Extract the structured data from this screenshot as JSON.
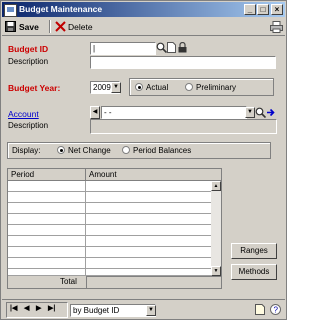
{
  "window": {
    "title": "Budget Maintenance",
    "minimize": "_",
    "maximize": "□",
    "close": "×"
  },
  "toolbar": {
    "save_label": "Save",
    "delete_label": "Delete"
  },
  "form": {
    "budget_id_label": "Budget ID",
    "budget_id_value": "|",
    "description_label": "Description",
    "description_value": "",
    "budget_year_label": "Budget Year:",
    "budget_year_value": "2009",
    "year_type_options": [
      "Actual",
      "Preliminary"
    ],
    "year_type_selected": "Actual",
    "account_label": "Account",
    "account_value": "   -   -",
    "account_description_label": "Description",
    "account_description_value": ""
  },
  "display": {
    "label": "Display:",
    "options": [
      "Net Change",
      "Period Balances"
    ],
    "selected": "Net Change"
  },
  "grid": {
    "columns": [
      "Period",
      "Amount"
    ],
    "rows": [
      "",
      "",
      "",
      "",
      "",
      "",
      "",
      "",
      ""
    ],
    "total_label": "Total"
  },
  "buttons": {
    "ranges": "Ranges",
    "methods": "Methods"
  },
  "statusbar": {
    "sort_value": "by Budget ID"
  }
}
